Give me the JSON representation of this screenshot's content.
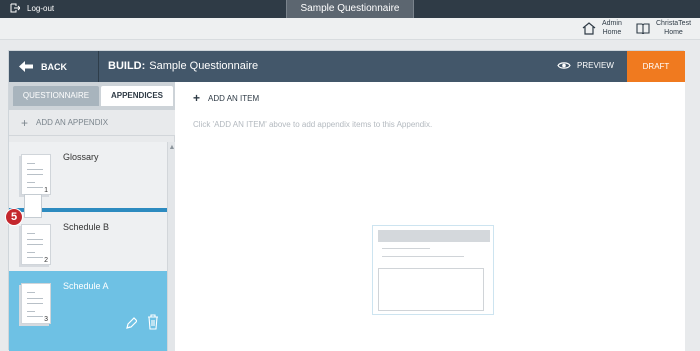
{
  "topbar": {
    "logout_label": "Log-out",
    "questionnaire_tab": "Sample Questionnaire"
  },
  "toplinks": {
    "admin_home_line1": "Admin",
    "admin_home_line2": "Home",
    "user_line1": "ChristaTest",
    "user_line2": "Home"
  },
  "header": {
    "back_label": "BACK",
    "build_prefix": "BUILD:",
    "build_title": "Sample Questionnaire",
    "preview_label": "PREVIEW",
    "status_label": "DRAFT"
  },
  "tabs": {
    "questionnaire": "QUESTIONNAIRE",
    "appendices": "APPENDICES"
  },
  "sidebar": {
    "add_appendix_label": "ADD AN APPENDIX",
    "step_badge": "5",
    "appendices": [
      {
        "label": "Glossary",
        "page": "1"
      },
      {
        "label": "Schedule B",
        "page": "2"
      },
      {
        "label": "Schedule A",
        "page": "3"
      }
    ]
  },
  "main": {
    "add_item_label": "ADD AN ITEM",
    "hint": "Click 'ADD AN ITEM' above to add appendix items to this Appendix."
  },
  "colors": {
    "header_bg": "#43576a",
    "draft_orange": "#f07a1f",
    "selected_blue": "#6ec1e4",
    "drop_line_blue": "#2d8bc0",
    "badge_red": "#c4272d"
  }
}
